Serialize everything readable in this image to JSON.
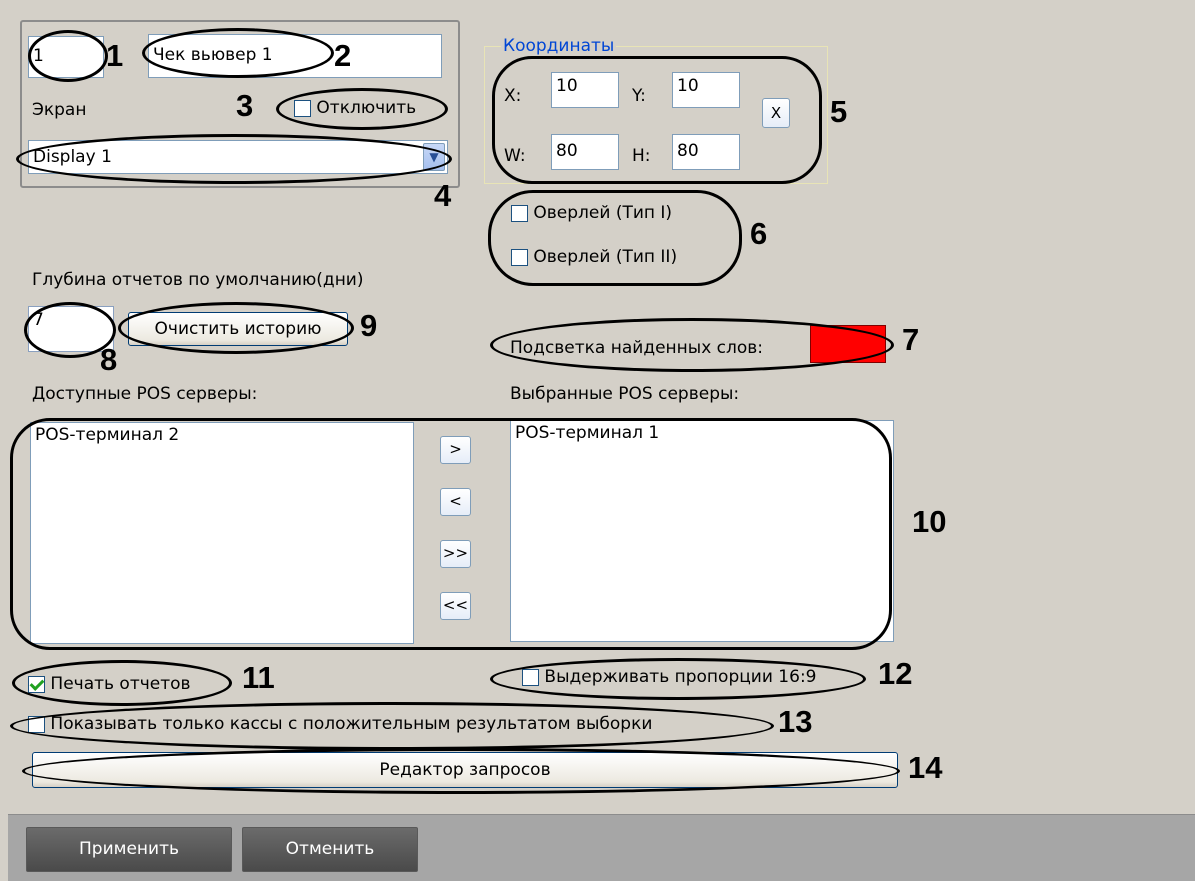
{
  "screen": {
    "id_value": "1",
    "name_value": "Чек вьювер 1",
    "screen_label": "Экран",
    "disable_label": "Отключить",
    "display_value": "Display 1"
  },
  "coords": {
    "legend": "Координаты",
    "x_label": "X:",
    "x_value": "10",
    "y_label": "Y:",
    "y_value": "10",
    "w_label": "W:",
    "w_value": "80",
    "h_label": "H:",
    "h_value": "80",
    "reset_glyph": "X"
  },
  "overlay": {
    "type1_label": "Оверлей (Тип I)",
    "type2_label": "Оверлей (Тип II)"
  },
  "history": {
    "depth_label": "Глубина отчетов по умолчанию(дни)",
    "depth_value": "7",
    "clear_button": "Очистить историю"
  },
  "highlight": {
    "label": "Подсветка найденных слов:",
    "color": "#ff0000"
  },
  "servers": {
    "available_label": "Доступные POS серверы:",
    "selected_label": "Выбранные POS серверы:",
    "available_items": [
      "POS-терминал 2"
    ],
    "selected_items": [
      "POS-терминал 1"
    ],
    "add_glyph": ">",
    "remove_glyph": "<",
    "add_all_glyph": ">>",
    "remove_all_glyph": "<<"
  },
  "options": {
    "print_reports": "Печать отчетов",
    "print_reports_checked": true,
    "keep_ratio": "Выдерживать пропорции 16:9",
    "positive_only": "Показывать только кассы с положительным результатом выборки"
  },
  "query_editor_button": "Редактор запросов",
  "footer": {
    "apply": "Применить",
    "cancel": "Отменить"
  },
  "callouts": [
    "1",
    "2",
    "3",
    "4",
    "5",
    "6",
    "7",
    "8",
    "9",
    "10",
    "11",
    "12",
    "13",
    "14"
  ]
}
